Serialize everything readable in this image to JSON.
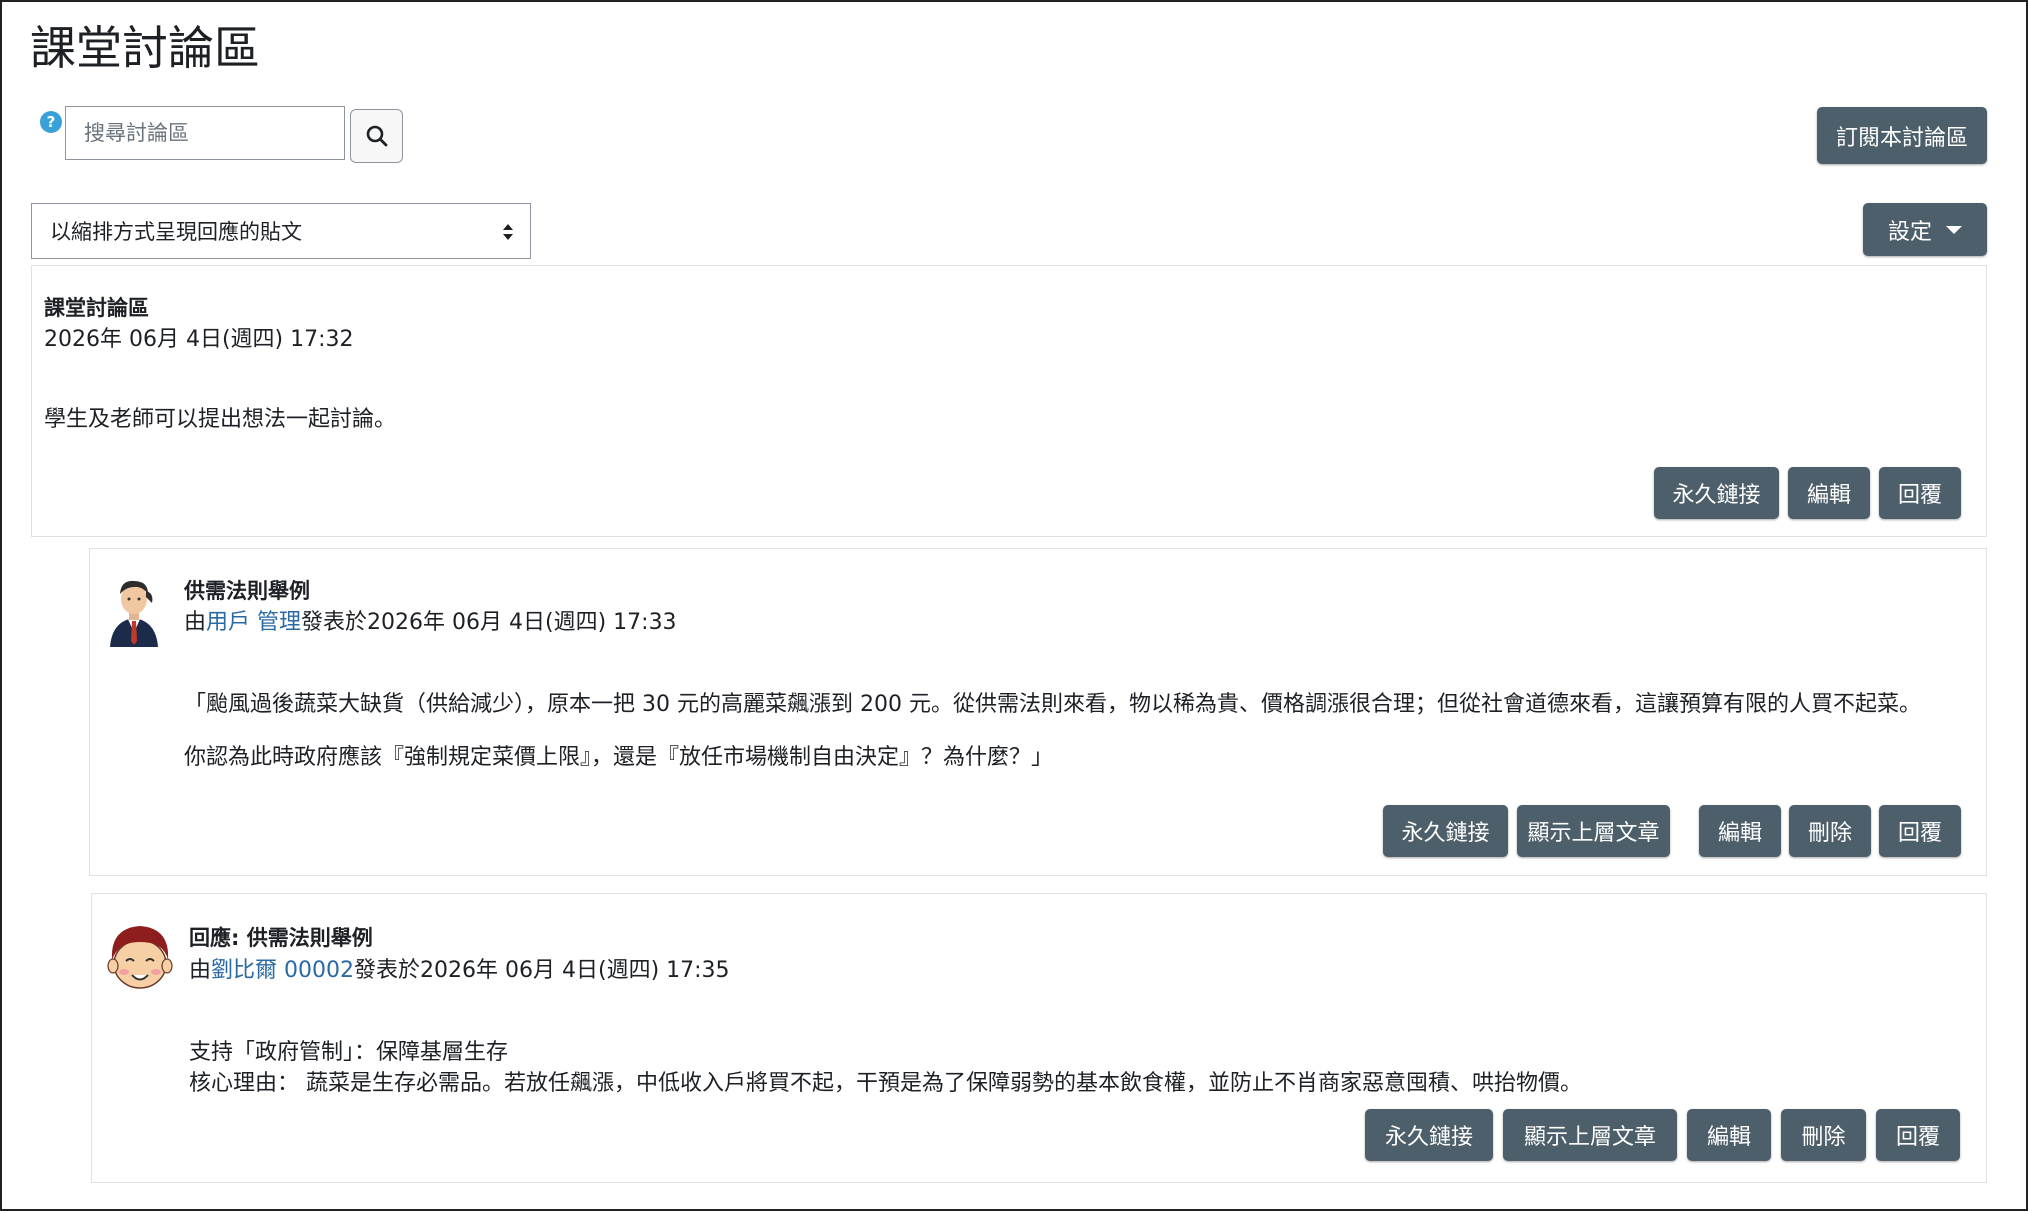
{
  "page": {
    "title": "課堂討論區"
  },
  "search": {
    "placeholder": "搜尋討論區",
    "help_icon": "?"
  },
  "subscribe_button": "訂閱本討論區",
  "display_mode": {
    "selected": "以縮排方式呈現回應的貼文"
  },
  "settings_button": "設定",
  "colors": {
    "button_bg": "#4d5f6a",
    "link": "#2a6aa4"
  },
  "posts": [
    {
      "subject": "課堂討論區",
      "datetime": "2026年 06月 4日(週四) 17:32",
      "body": [
        "學生及老師可以提出想法一起討論。"
      ],
      "actions": [
        "永久鏈接",
        "編輯",
        "回覆"
      ]
    },
    {
      "subject": "供需法則舉例",
      "by_prefix": "由",
      "author": "用戶 管理",
      "posted_prefix": "發表於",
      "datetime": "2026年 06月 4日(週四) 17:33",
      "avatar_icon": "manager-avatar-icon",
      "body": [
        "「颱風過後蔬菜大缺貨（供給減少），原本一把 30 元的高麗菜飆漲到 200 元。從供需法則來看，物以稀為貴、價格調漲很合理；但從社會道德來看，這讓預算有限的人買不起菜。",
        "你認為此時政府應該『強制規定菜價上限』，還是『放任市場機制自由決定』？為什麼？」"
      ],
      "actions": [
        "永久鏈接",
        "顯示上層文章",
        "編輯",
        "刪除",
        "回覆"
      ]
    },
    {
      "subject": "回應: 供需法則舉例",
      "by_prefix": "由",
      "author": "劉比爾 00002",
      "posted_prefix": "發表於",
      "datetime": "2026年 06月 4日(週四) 17:35",
      "avatar_icon": "student-avatar-icon",
      "body": [
        "支持「政府管制」：保障基層生存",
        "核心理由： 蔬菜是生存必需品。若放任飆漲，中低收入戶將買不起，干預是為了保障弱勢的基本飲食權，並防止不肖商家惡意囤積、哄抬物價。"
      ],
      "actions": [
        "永久鏈接",
        "顯示上層文章",
        "編輯",
        "刪除",
        "回覆"
      ]
    }
  ]
}
